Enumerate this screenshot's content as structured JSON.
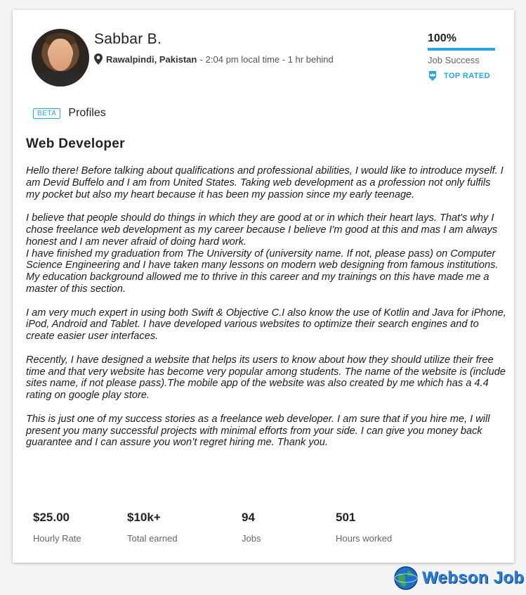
{
  "profile": {
    "name": "Sabbar B.",
    "city": "Rawalpindi, Pakistan",
    "separator": "-",
    "local_time": "2:04 pm local time - 1 hr behind"
  },
  "job_success": {
    "percent_label": "100%",
    "percent_value": 100,
    "label": "Job Success",
    "top_rated_label": "TOP RATED",
    "accent_color": "#27a6e1"
  },
  "profiles_section": {
    "badge": "BETA",
    "label": "Profiles"
  },
  "job_title": "Web Developer",
  "description": "Hello there! Before talking about qualifications and professional abilities, I would like to introduce myself. I am Devid Buffelo and I am from United States. Taking web development as a profession not only fulfils my pocket but also my heart because it has been my passion since my early teenage.\n\nI believe that people should do things in which they are good at or in which their heart lays. That's why I chose freelance web development as my career because I believe I'm good at this and mas I am always honest and I am never afraid of doing hard work.\nI have finished my graduation from The University of (university name. If not, please pass) on Computer Science Engineering and I have taken many lessons on modern web designing from famous institutions. My education background allowed me to thrive in this career and my trainings on this have made me a master of this section.\n\nI am very much expert in using both Swift & Objective C.I also know the use of Kotlin and Java for iPhone, iPod, Android and Tablet. I have developed various websites to optimize their search engines and to create easier user interfaces.\n\nRecently, I have designed a website that helps its users to know about how they should utilize their free time and that very website has become very popular among students. The name of the website is (include sites name, if not please pass).The mobile app of the website was also created by me which has a 4.4 rating on google play store.\n\nThis is just one of my success stories as a freelance web developer. I am sure that if you hire me, I will present you many successful projects with minimal efforts from your side. I can give you money back guarantee and I can assure you won’t regret hiring me. Thank you.",
  "stats": [
    {
      "value": "$25.00",
      "label": "Hourly Rate"
    },
    {
      "value": "$10k+",
      "label": "Total earned"
    },
    {
      "value": "94",
      "label": "Jobs"
    },
    {
      "value": "501",
      "label": "Hours worked"
    }
  ],
  "watermark": {
    "text": "Webson Job",
    "icon": "globe-icon"
  }
}
